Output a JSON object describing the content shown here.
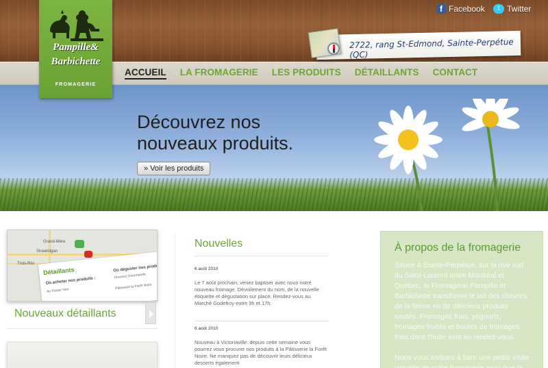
{
  "brand": {
    "name_line1": "Pampille&",
    "name_line2": "Barbichette",
    "tagline": "FROMAGERIE"
  },
  "social": {
    "facebook_label": "Facebook",
    "twitter_label": "Twitter"
  },
  "address": "2722, rang St-Edmond, Sainte-Perpétue (QC)",
  "nav": {
    "items": [
      {
        "label": "ACCUEIL",
        "active": true
      },
      {
        "label": "LA FROMAGERIE"
      },
      {
        "label": "LES PRODUITS"
      },
      {
        "label": "DÉTAILLANTS"
      },
      {
        "label": "CONTACT"
      }
    ]
  },
  "hero": {
    "title_line1": "Découvrez nos",
    "title_line2": "nouveaux produits.",
    "button_label": "» Voir les produits"
  },
  "retailers": {
    "title": "Nouveaux détaillants",
    "card_heading": "Détaillants",
    "q1": "Où acheter nos produits :",
    "a1": "Au Panier Noir",
    "q2": "Où déguster nos produits",
    "a2": "Douceur Gourmande",
    "a3": "Pâtisserie la Forêt Noire",
    "map_labels": [
      "Grand-Mère",
      "Shawinigan",
      "Trois-Rivi"
    ]
  },
  "news": {
    "title": "Nouvelles",
    "items": [
      {
        "date": "6 août 2010",
        "body": "Le 7 août prochain, venez baptiser avec nous notre nouveau fromage. Dévoilement du nom, de la nouvelle étiquette et dégustation sur place. Rendez-vous au Marché Godefroy entre 9h et 17h."
      },
      {
        "date": "6 août 2010",
        "body": "Nouveau à Victoriaville: depuis cette semaine vous pourrez vous procurer nos produits à la Pâtisserie la Forêt Noire. Ne manquez pas de découvrir leurs délicieux desserts également"
      }
    ]
  },
  "about": {
    "title": "À propos de la fromagerie",
    "paragraph1": "Située à Sainte-Perpétue, sur la rive sud du Saint-Laurent entre Montréal et Québec, la Fromagerie Pampille et Barbichette transforme le lait des chèvres de la ferme en de délicieux produits santés. Fromages frais, yogourts, fromages fruités et boules de fromages frais dans l'huile sont au rendez-vous.",
    "paragraph2": "Nous vous invitons à faire une petite visite virtuelle de notre fromagerie ainsi que la"
  },
  "colors": {
    "accent_green": "#6aa72e",
    "logo_green": "#7cb342",
    "about_bg": "#d7e7c6",
    "address_ink": "#243a74"
  }
}
